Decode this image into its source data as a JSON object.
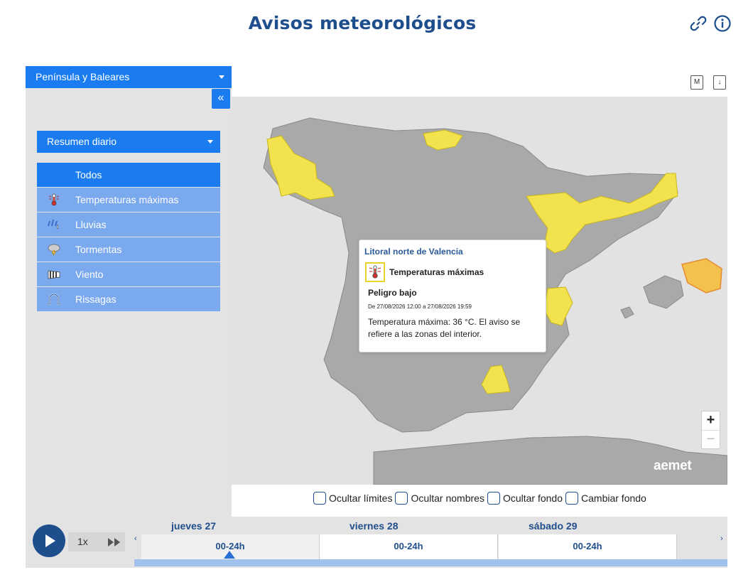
{
  "header": {
    "title": "Avisos meteorológicos",
    "icons": [
      "link-icon",
      "info-icon"
    ]
  },
  "region_selector": {
    "value": "Península y Baleares"
  },
  "sidebar": {
    "collapse_label": "«",
    "summary_selector": {
      "value": "Resumen diario"
    },
    "filters": [
      {
        "label": "Todos",
        "icon": "none",
        "active": true
      },
      {
        "label": "Temperaturas máximas",
        "icon": "thermometer-icon",
        "active": false
      },
      {
        "label": "Lluvias",
        "icon": "rain-icon",
        "active": false
      },
      {
        "label": "Tormentas",
        "icon": "storm-icon",
        "active": false
      },
      {
        "label": "Viento",
        "icon": "wind-icon",
        "active": false
      },
      {
        "label": "Rissagas",
        "icon": "wave-icon",
        "active": false
      }
    ]
  },
  "map_toolbar": {
    "map_label": "M",
    "download_label": "↓"
  },
  "map": {
    "colors": {
      "land": "#a8a8a8",
      "sea": "#e2e2e2",
      "yellow_warning": "#f2e24e",
      "orange_warning": "#f2c14e"
    },
    "logo": "aemet",
    "zoom_in": "+",
    "zoom_out": "−"
  },
  "popup": {
    "region": "Litoral norte de Valencia",
    "warning_type": "Temperaturas máximas",
    "level": "Peligro bajo",
    "period": "De 27/08/2026 12:00 a 27/08/2026 19:59",
    "description": "Temperatura máxima: 36 °C. El aviso se refiere a las zonas del interior."
  },
  "map_options": [
    {
      "label": "Ocultar límites",
      "checked": false
    },
    {
      "label": "Ocultar nombres",
      "checked": false
    },
    {
      "label": "Ocultar fondo",
      "checked": false
    },
    {
      "label": "Cambiar fondo",
      "checked": false
    }
  ],
  "timeline": {
    "speed": "1x",
    "days": [
      {
        "name": "jueves 27",
        "slot": "00-24h",
        "selected": true
      },
      {
        "name": "viernes 28",
        "slot": "00-24h",
        "selected": false
      },
      {
        "name": "sábado 29",
        "slot": "00-24h",
        "selected": false
      }
    ]
  }
}
